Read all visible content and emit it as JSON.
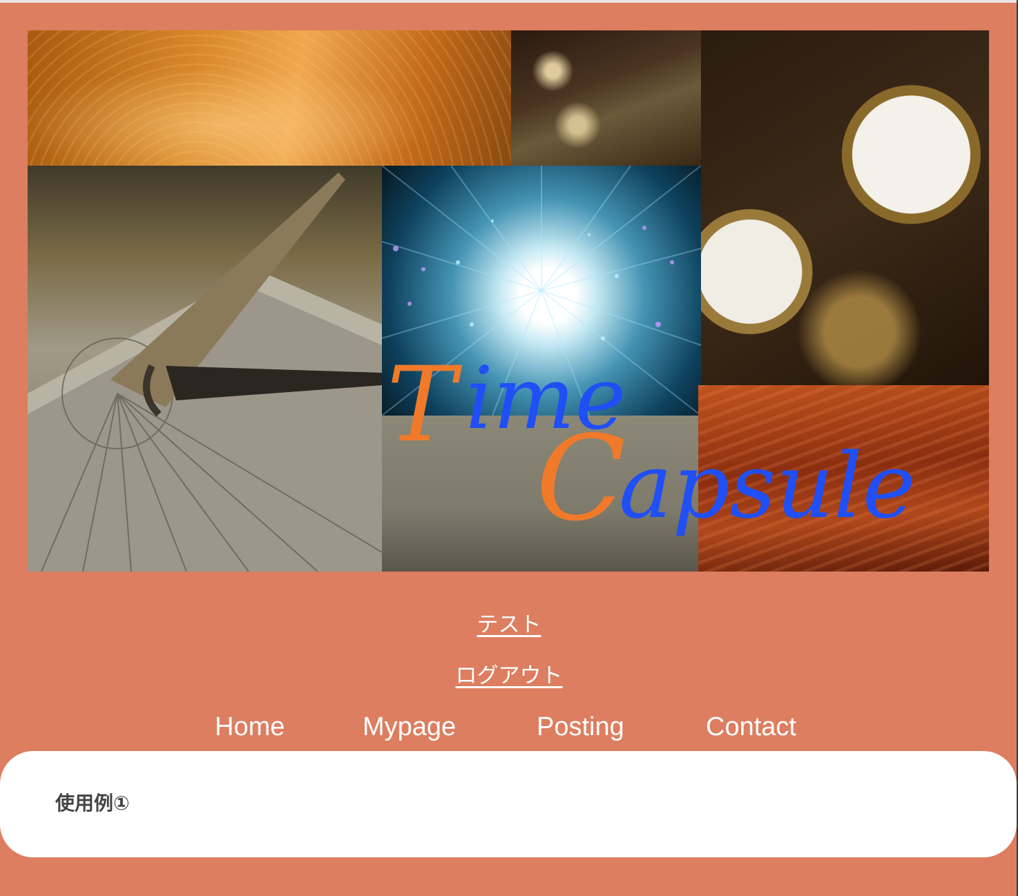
{
  "banner": {
    "logo_first": "T",
    "logo_word1_rest": "ime",
    "logo_second": "C",
    "logo_word2_rest": "apsule",
    "logo_accent_color": "#f07a2a",
    "logo_main_color": "#1f4ff5"
  },
  "links": {
    "test": "テスト",
    "logout": "ログアウト"
  },
  "menu": {
    "items": [
      {
        "label": "Home"
      },
      {
        "label": "Mypage"
      },
      {
        "label": "Posting"
      },
      {
        "label": "Contact"
      }
    ]
  },
  "content": {
    "title": "使用例①"
  },
  "colors": {
    "page_background": "#dd7e60",
    "card_background": "#ffffff"
  }
}
